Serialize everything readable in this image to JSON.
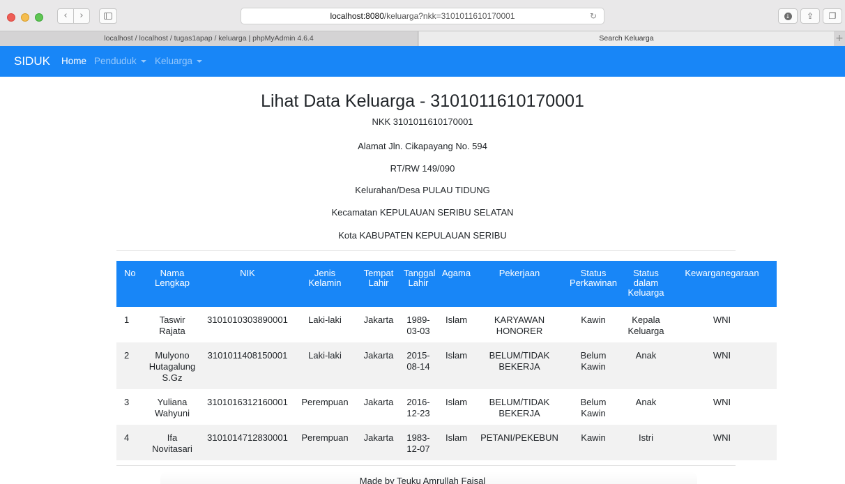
{
  "browser": {
    "url_host": "localhost:8080",
    "url_rest": "/keluarga?nkk=3101011610170001",
    "tabs": [
      {
        "label": "localhost / localhost / tugas1apap / keluarga | phpMyAdmin 4.6.4"
      },
      {
        "label": "Search Keluarga"
      }
    ],
    "icons": {
      "back": "chevron-left-icon",
      "forward": "chevron-right-icon",
      "sidebar": "sidebar-icon",
      "reload": "reload-icon",
      "download": "download-icon",
      "share": "share-icon",
      "tabs": "tabs-overview-icon",
      "new_tab": "plus-icon"
    }
  },
  "navbar": {
    "brand": "SIDUK",
    "items": [
      {
        "label": "Home"
      },
      {
        "label": "Penduduk"
      },
      {
        "label": "Keluarga"
      }
    ],
    "color": "#1886f7"
  },
  "page": {
    "title": "Lihat Data Keluarga - 3101011610170001",
    "nkk": "NKK 3101011610170001",
    "alamat": "Alamat Jln. Cikapayang No. 594",
    "rtrw": "RT/RW 149/090",
    "kelurahan": "Kelurahan/Desa PULAU TIDUNG",
    "kecamatan": "Kecamatan KEPULAUAN SERIBU SELATAN",
    "kota": "Kota KABUPATEN KEPULAUAN SERIBU"
  },
  "table": {
    "headers": {
      "no": "No",
      "nama_1": "Nama",
      "nama_2": "Lengkap",
      "nik": "NIK",
      "jk_1": "Jenis",
      "jk_2": "Kelamin",
      "tempat_1": "Tempat",
      "tempat_2": "Lahir",
      "tanggal_1": "Tanggal",
      "tanggal_2": "Lahir",
      "agama": "Agama",
      "pekerjaan": "Pekerjaan",
      "perkawinan_1": "Status",
      "perkawinan_2": "Perkawinan",
      "keluarga_1": "Status",
      "keluarga_2": "dalam",
      "keluarga_3": "Keluarga",
      "kewarganegaraan": "Kewarganegaraan"
    },
    "rows": [
      {
        "no": "1",
        "nama": [
          "Taswir",
          "Rajata"
        ],
        "nik": "3101010303890001",
        "jk": "Laki-laki",
        "tempat": "Jakarta",
        "tanggal": [
          "1989-",
          "03-03"
        ],
        "agama": "Islam",
        "pekerjaan": [
          "KARYAWAN",
          "HONORER"
        ],
        "perkawinan": [
          "Kawin"
        ],
        "keluarga": [
          "Kepala",
          "Keluarga"
        ],
        "kewarganegaraan": "WNI"
      },
      {
        "no": "2",
        "nama": [
          "Mulyono",
          "Hutagalung",
          "S.Gz"
        ],
        "nik": "3101011408150001",
        "jk": "Laki-laki",
        "tempat": "Jakarta",
        "tanggal": [
          "2015-",
          "08-14"
        ],
        "agama": "Islam",
        "pekerjaan": [
          "BELUM/TIDAK",
          "BEKERJA"
        ],
        "perkawinan": [
          "Belum",
          "Kawin"
        ],
        "keluarga": [
          "Anak"
        ],
        "kewarganegaraan": "WNI"
      },
      {
        "no": "3",
        "nama": [
          "Yuliana",
          "Wahyuni"
        ],
        "nik": "3101016312160001",
        "jk": "Perempuan",
        "tempat": "Jakarta",
        "tanggal": [
          "2016-",
          "12-23"
        ],
        "agama": "Islam",
        "pekerjaan": [
          "BELUM/TIDAK",
          "BEKERJA"
        ],
        "perkawinan": [
          "Belum",
          "Kawin"
        ],
        "keluarga": [
          "Anak"
        ],
        "kewarganegaraan": "WNI"
      },
      {
        "no": "4",
        "nama": [
          "Ifa",
          "Novitasari"
        ],
        "nik": "3101014712830001",
        "jk": "Perempuan",
        "tempat": "Jakarta",
        "tanggal": [
          "1983-",
          "12-07"
        ],
        "agama": "Islam",
        "pekerjaan": [
          "PETANI/PEKEBUN"
        ],
        "perkawinan": [
          "Kawin"
        ],
        "keluarga": [
          "Istri"
        ],
        "kewarganegaraan": "WNI"
      }
    ]
  },
  "footer": {
    "text": "Made by Teuku Amrullah Faisal"
  }
}
